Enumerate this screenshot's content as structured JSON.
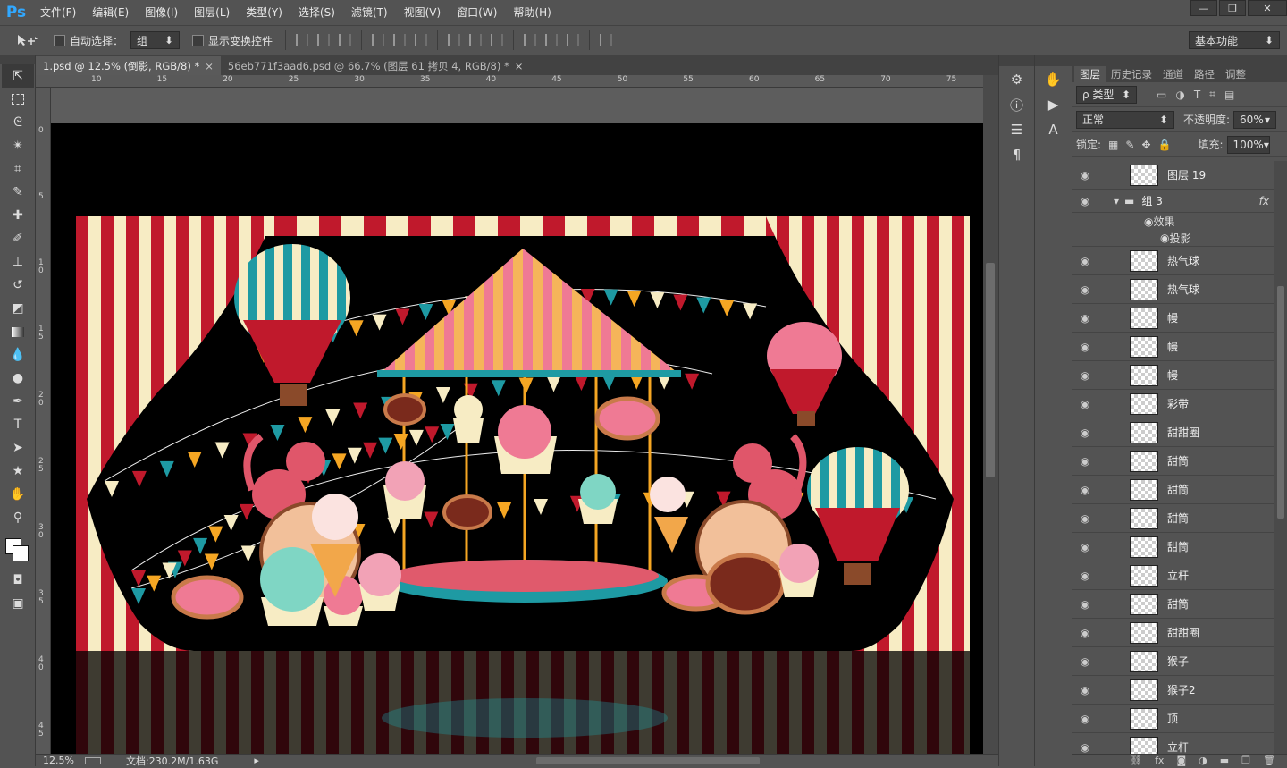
{
  "app": {
    "logo": "Ps"
  },
  "menu": [
    "文件(F)",
    "编辑(E)",
    "图像(I)",
    "图层(L)",
    "类型(Y)",
    "选择(S)",
    "滤镜(T)",
    "视图(V)",
    "窗口(W)",
    "帮助(H)"
  ],
  "window_buttons": [
    "—",
    "❐",
    "✕"
  ],
  "options": {
    "auto_select_label": "自动选择：",
    "auto_select_value": "组",
    "show_transform_label": "显示变换控件",
    "workspace": "基本功能"
  },
  "doc_tabs": [
    {
      "label": "1.psd @ 12.5% (倒影, RGB/8) *",
      "close": "×"
    },
    {
      "label": "56eb771f3aad6.psd @ 66.7% (图层 61 拷贝 4, RGB/8) *",
      "close": "×"
    }
  ],
  "ruler_h": [
    "10",
    "15",
    "20",
    "25",
    "30",
    "35",
    "40",
    "45",
    "50",
    "55",
    "60",
    "65",
    "70",
    "75"
  ],
  "ruler_v": [
    "0",
    "5",
    "1 0",
    "1 5",
    "2 0",
    "2 5",
    "3 0",
    "3 5",
    "4 0",
    "4 5"
  ],
  "status": {
    "zoom": "12.5%",
    "doc": "文档:230.2M/1.63G"
  },
  "panel": {
    "tabs": [
      "图层",
      "历史记录",
      "通道",
      "路径",
      "调整"
    ],
    "filter_label": "ρ 类型",
    "blend_mode": "正常",
    "opacity_label": "不透明度:",
    "opacity_value": "60%",
    "lock_label": "锁定:",
    "fill_label": "填充:",
    "fill_value": "100%",
    "top_layer": "图层 19",
    "group_name": "组 3",
    "effects_label": "效果",
    "shadow_label": "投影",
    "fx": "fx",
    "layers": [
      "热气球",
      "热气球",
      "幔",
      "幔",
      "幔",
      "彩带",
      "甜甜圈",
      "甜筒",
      "甜筒",
      "甜筒",
      "甜筒",
      "立杆",
      "甜筒",
      "甜甜圈",
      "猴子",
      "猴子2",
      "顶",
      "立杆"
    ]
  },
  "colors": {
    "red": "#c0192c",
    "cream": "#f7ecc4",
    "teal": "#1e9aa3",
    "pink": "#ef7a94",
    "orange": "#f5a623",
    "brown": "#5a2a1c"
  }
}
